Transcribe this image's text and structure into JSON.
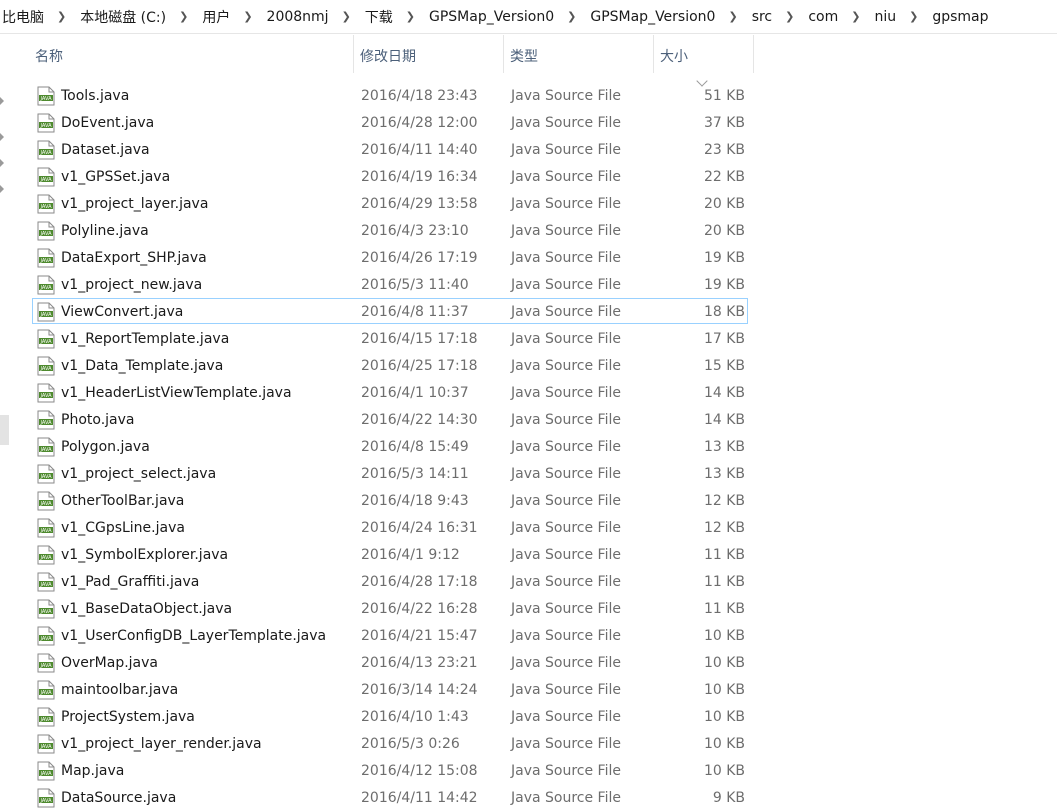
{
  "breadcrumb": [
    "比电脑",
    "本地磁盘 (C:)",
    "用户",
    "2008nmj",
    "下载",
    "GPSMap_Version0",
    "GPSMap_Version0",
    "src",
    "com",
    "niu",
    "gpsmap"
  ],
  "columns": {
    "name": "名称",
    "date": "修改日期",
    "type": "类型",
    "size": "大小"
  },
  "icons": {
    "file": "java-file-icon",
    "sort": "chevron-down-icon",
    "separator": "chevron-right-icon"
  },
  "colors": {
    "selection_border": "#99d1ff",
    "header_text": "#4c607a",
    "icon_green": "#4e8a2e"
  },
  "files": [
    {
      "name": "Tools.java",
      "date": "2016/4/18 23:43",
      "type": "Java Source File",
      "size": "51 KB"
    },
    {
      "name": "DoEvent.java",
      "date": "2016/4/28 12:00",
      "type": "Java Source File",
      "size": "37 KB"
    },
    {
      "name": "Dataset.java",
      "date": "2016/4/11 14:40",
      "type": "Java Source File",
      "size": "23 KB"
    },
    {
      "name": "v1_GPSSet.java",
      "date": "2016/4/19 16:34",
      "type": "Java Source File",
      "size": "22 KB"
    },
    {
      "name": "v1_project_layer.java",
      "date": "2016/4/29 13:58",
      "type": "Java Source File",
      "size": "20 KB"
    },
    {
      "name": "Polyline.java",
      "date": "2016/4/3 23:10",
      "type": "Java Source File",
      "size": "20 KB"
    },
    {
      "name": "DataExport_SHP.java",
      "date": "2016/4/26 17:19",
      "type": "Java Source File",
      "size": "19 KB"
    },
    {
      "name": "v1_project_new.java",
      "date": "2016/5/3 11:40",
      "type": "Java Source File",
      "size": "19 KB"
    },
    {
      "name": "ViewConvert.java",
      "date": "2016/4/8 11:37",
      "type": "Java Source File",
      "size": "18 KB",
      "selected": true
    },
    {
      "name": "v1_ReportTemplate.java",
      "date": "2016/4/15 17:18",
      "type": "Java Source File",
      "size": "17 KB"
    },
    {
      "name": "v1_Data_Template.java",
      "date": "2016/4/25 17:18",
      "type": "Java Source File",
      "size": "15 KB"
    },
    {
      "name": "v1_HeaderListViewTemplate.java",
      "date": "2016/4/1 10:37",
      "type": "Java Source File",
      "size": "14 KB"
    },
    {
      "name": "Photo.java",
      "date": "2016/4/22 14:30",
      "type": "Java Source File",
      "size": "14 KB"
    },
    {
      "name": "Polygon.java",
      "date": "2016/4/8 15:49",
      "type": "Java Source File",
      "size": "13 KB"
    },
    {
      "name": "v1_project_select.java",
      "date": "2016/5/3 14:11",
      "type": "Java Source File",
      "size": "13 KB"
    },
    {
      "name": "OtherToolBar.java",
      "date": "2016/4/18 9:43",
      "type": "Java Source File",
      "size": "12 KB"
    },
    {
      "name": "v1_CGpsLine.java",
      "date": "2016/4/24 16:31",
      "type": "Java Source File",
      "size": "12 KB"
    },
    {
      "name": "v1_SymbolExplorer.java",
      "date": "2016/4/1 9:12",
      "type": "Java Source File",
      "size": "11 KB"
    },
    {
      "name": "v1_Pad_Graffiti.java",
      "date": "2016/4/28 17:18",
      "type": "Java Source File",
      "size": "11 KB"
    },
    {
      "name": "v1_BaseDataObject.java",
      "date": "2016/4/22 16:28",
      "type": "Java Source File",
      "size": "11 KB"
    },
    {
      "name": "v1_UserConfigDB_LayerTemplate.java",
      "date": "2016/4/21 15:47",
      "type": "Java Source File",
      "size": "10 KB"
    },
    {
      "name": "OverMap.java",
      "date": "2016/4/13 23:21",
      "type": "Java Source File",
      "size": "10 KB"
    },
    {
      "name": "maintoolbar.java",
      "date": "2016/3/14 14:24",
      "type": "Java Source File",
      "size": "10 KB"
    },
    {
      "name": "ProjectSystem.java",
      "date": "2016/4/10 1:43",
      "type": "Java Source File",
      "size": "10 KB"
    },
    {
      "name": "v1_project_layer_render.java",
      "date": "2016/5/3 0:26",
      "type": "Java Source File",
      "size": "10 KB"
    },
    {
      "name": "Map.java",
      "date": "2016/4/12 15:08",
      "type": "Java Source File",
      "size": "10 KB"
    },
    {
      "name": "DataSource.java",
      "date": "2016/4/11 14:42",
      "type": "Java Source File",
      "size": "9 KB"
    }
  ]
}
